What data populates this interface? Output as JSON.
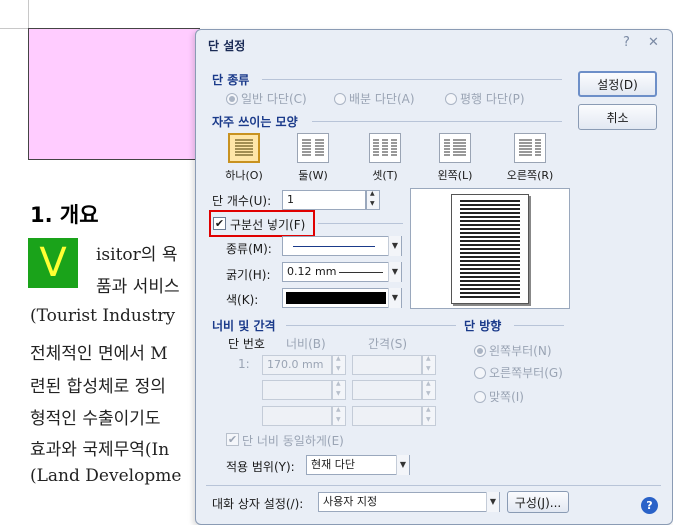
{
  "document": {
    "heading": "1. 개요",
    "dropcap": "V",
    "lines": [
      "isitor의 욕",
      "품과 서비스",
      "(Tourist Industry",
      "전체적인 면에서 M",
      "련된 합성체로 정의",
      "형적인 수출이기도",
      "효과와 국제무역(In",
      "(Land Developme"
    ]
  },
  "dialog": {
    "title": "단 설정",
    "help_symbol": "?",
    "close_symbol": "✕",
    "column_type": {
      "label": "단 종류",
      "options": [
        "일반 다단(C)",
        "배분 다단(A)",
        "평행 다단(P)"
      ]
    },
    "presets": {
      "label": "자주 쓰이는 모양",
      "items": [
        "하나(O)",
        "둘(W)",
        "셋(T)",
        "왼쪽(L)",
        "오른쪽(R)"
      ]
    },
    "column_count": {
      "label": "단 개수(U):",
      "value": "1"
    },
    "divider": {
      "checkbox_label": "구분선 넣기(F)",
      "checked": "✔",
      "type_label": "종류(M):",
      "thickness_label": "굵기(H):",
      "thickness_value": "0.12 mm",
      "color_label": "색(K):",
      "color_value": "#000000"
    },
    "width_spacing": {
      "label": "너비 및 간격",
      "col_number": "단 번호",
      "width": "너비(B)",
      "gap": "간격(S)",
      "row_index": "1:",
      "row_width": "170.0 mm",
      "equal_width_label": "단 너비 동일하게(E)"
    },
    "direction": {
      "label": "단 방향",
      "options": [
        "왼쪽부터(N)",
        "오른쪽부터(G)",
        "맞쪽(I)"
      ]
    },
    "apply_range": {
      "label": "적용 범위(Y):",
      "value": "현재 다단"
    },
    "buttons": {
      "ok": "설정(D)",
      "cancel": "취소",
      "config": "구성(J)..."
    },
    "dialog_setting": {
      "label": "대화 상자 설정(/):",
      "value": "사용자 지정"
    },
    "help_button": "?"
  },
  "colors": {
    "pink_box": "#ffccff",
    "dropcap_bg": "#1aa31a",
    "dropcap_fg": "#ffff33",
    "highlight": "#e00000",
    "dialog_bg": "#e9eef6",
    "section_label": "#1a3a8a"
  }
}
